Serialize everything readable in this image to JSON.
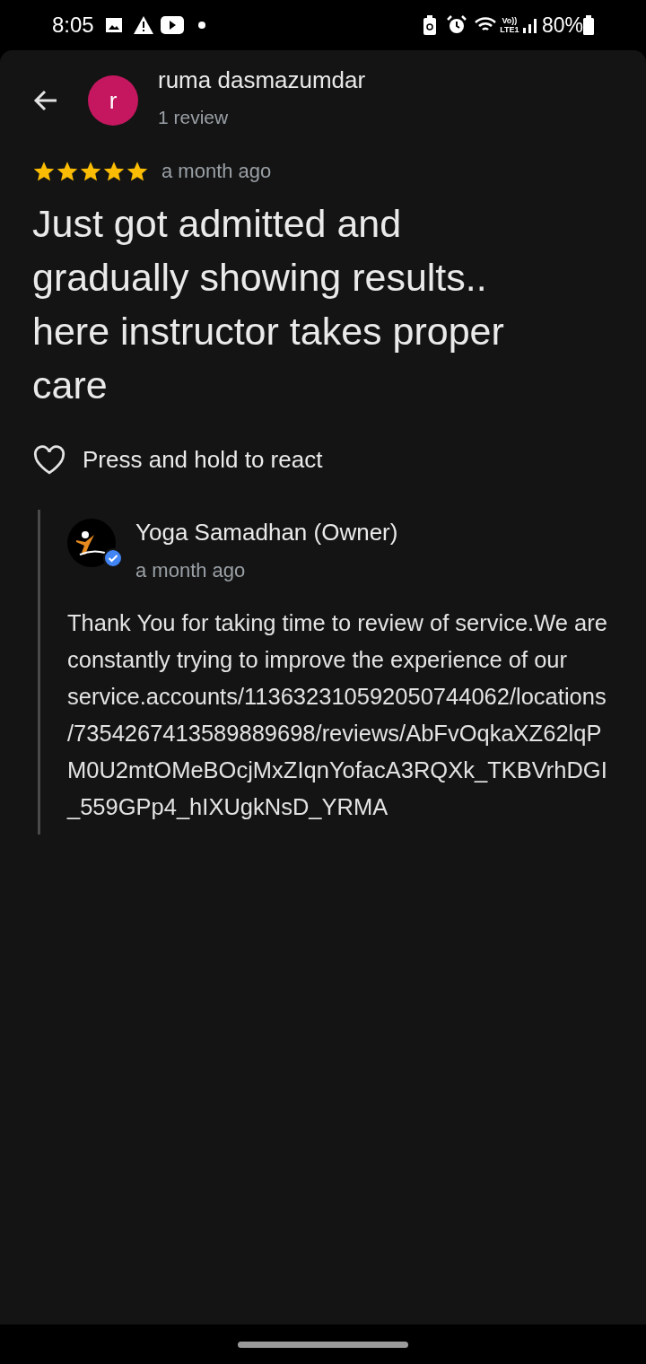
{
  "status_bar": {
    "time": "8:05",
    "battery": "80%",
    "network": "Vo)) LTE1"
  },
  "reviewer": {
    "initial": "r",
    "name": "ruma dasmazumdar",
    "reviews": "1 review"
  },
  "review": {
    "stars": 5,
    "time": "a month ago",
    "text": "Just got admitted and gradually showing results.. here instructor takes proper care"
  },
  "react": {
    "label": "Press and hold to react",
    "liked": false
  },
  "owner_reply": {
    "name": "Yoga Samadhan (Owner)",
    "verified": true,
    "time": "a month ago",
    "text": "Thank You for taking time to review of service.We are constantly trying to improve the experience of our service.accounts/113632310592050744062/locations/7354267413589889698/reviews/AbFvOqkaXZ62lqPM0U2mtOMeBOcjMxZIqnYofacA3RQXk_TKBVrhDGI_559GPp4_hIXUgkNsD_YRMA"
  }
}
